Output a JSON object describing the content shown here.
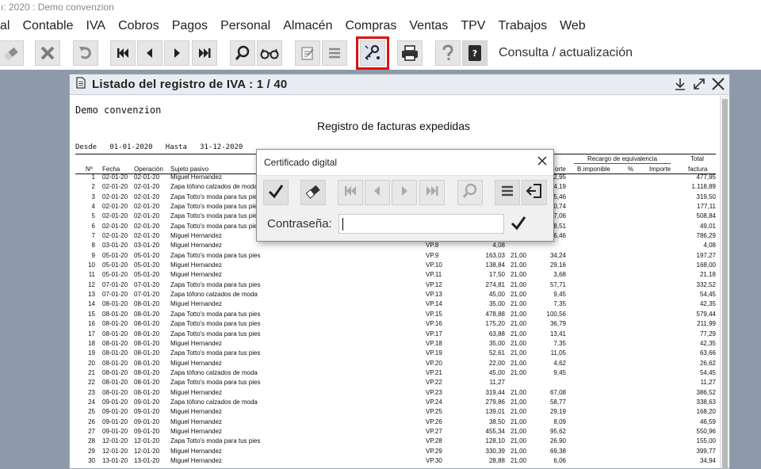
{
  "app": {
    "window_title": "ı: 2020 : Demo convenzion"
  },
  "menu": [
    "al",
    "Contable",
    "IVA",
    "Cobros",
    "Pagos",
    "Personal",
    "Almacén",
    "Compras",
    "Ventas",
    "TPV",
    "Trabajos",
    "Web"
  ],
  "toolbar": {
    "status_label": "Consulta / actualización",
    "buttons": [
      "eraser-icon",
      "close-icon",
      "undo-icon",
      "first-icon",
      "prev-icon",
      "next-icon",
      "last-icon",
      "search-icon",
      "glasses-icon",
      "edit-icon",
      "list-icon",
      "digital-certificate-icon",
      "printer-icon",
      "help-icon",
      "calculator-icon"
    ],
    "highlight_color": "#e01010"
  },
  "document": {
    "title": "Listado del registro de IVA  :  1  /  40",
    "company": "Demo convenzion",
    "report_title": "Registro de facturas expedidas",
    "range": "Desde   01-01-2020   Hasta   31-12-2020",
    "headers": {
      "num": "Nº",
      "fecha": "Fecha",
      "operacion": "Operación",
      "sujeto": "Sujeto pasivo",
      "cuota_importe": "orte",
      "recargo": "Recargo de equivalencia",
      "recargo_base": "B.imponible",
      "recargo_pct": "%",
      "recargo_importe": "Importe",
      "total": "Total",
      "total_sub": "factura"
    },
    "rows": [
      {
        "n": "1",
        "f": "02-01-20",
        "o": "02-01-20",
        "s": "Miguel Hernandez",
        "d": "",
        "b": "",
        "p": "",
        "i": "2,95",
        "t": "477,95"
      },
      {
        "n": "2",
        "f": "02-01-20",
        "o": "02-01-20",
        "s": "Zapa tófono calzados de moda",
        "d": "",
        "b": "",
        "p": "",
        "i": "4,19",
        "t": "1.118,89"
      },
      {
        "n": "3",
        "f": "02-01-20",
        "o": "02-01-20",
        "s": "Zapa Totto's moda para tus pies",
        "d": "",
        "b": "",
        "p": "",
        "i": "5,46",
        "t": "319,50"
      },
      {
        "n": "4",
        "f": "02-01-20",
        "o": "02-01-20",
        "s": "Zapa Totto's moda para tus pies",
        "d": "",
        "b": "",
        "p": "",
        "i": "0,74",
        "t": "177,11"
      },
      {
        "n": "5",
        "f": "02-01-20",
        "o": "02-01-20",
        "s": "Zapa Totto's moda para tus pies",
        "d": "",
        "b": "",
        "p": "",
        "i": "7,06",
        "t": "508,84"
      },
      {
        "n": "6",
        "f": "02-01-20",
        "o": "02-01-20",
        "s": "Zapa Totto's moda para tus pies",
        "d": "",
        "b": "",
        "p": "",
        "i": "8,51",
        "t": "49,01"
      },
      {
        "n": "7",
        "f": "02-01-20",
        "o": "02-01-20",
        "s": "Miguel Hernandez",
        "d": "",
        "b": "",
        "p": "",
        "i": "6,46",
        "t": "786,29"
      },
      {
        "n": "8",
        "f": "03-01-20",
        "o": "03-01-20",
        "s": "Miguel Hernandez",
        "d": "VP.8",
        "b": "4,08",
        "p": "",
        "i": "",
        "t": "4,08"
      },
      {
        "n": "9",
        "f": "05-01-20",
        "o": "05-01-20",
        "s": "Zapa Totto's moda para tus pies",
        "d": "VP.9",
        "b": "163,03",
        "p": "21,00",
        "i": "34,24",
        "t": "197,27"
      },
      {
        "n": "10",
        "f": "05-01-20",
        "o": "05-01-20",
        "s": "Miguel Hernandez",
        "d": "VP.10",
        "b": "138,84",
        "p": "21,00",
        "i": "29,16",
        "t": "168,00"
      },
      {
        "n": "11",
        "f": "05-01-20",
        "o": "05-01-20",
        "s": "Miguel Hernandez",
        "d": "VP.11",
        "b": "17,50",
        "p": "21,00",
        "i": "3,68",
        "t": "21,18"
      },
      {
        "n": "12",
        "f": "07-01-20",
        "o": "07-01-20",
        "s": "Zapa Totto's moda para tus pies",
        "d": "VP.12",
        "b": "274,81",
        "p": "21,00",
        "i": "57,71",
        "t": "332,52"
      },
      {
        "n": "13",
        "f": "07-01-20",
        "o": "07-01-20",
        "s": "Zapa tófono calzados de moda",
        "d": "VP.13",
        "b": "45,00",
        "p": "21,00",
        "i": "9,45",
        "t": "54,45"
      },
      {
        "n": "14",
        "f": "08-01-20",
        "o": "08-01-20",
        "s": "Miguel Hernandez",
        "d": "VP.14",
        "b": "35,00",
        "p": "21,00",
        "i": "7,35",
        "t": "42,35"
      },
      {
        "n": "15",
        "f": "08-01-20",
        "o": "08-01-20",
        "s": "Zapa Totto's moda para tus pies",
        "d": "VP.15",
        "b": "478,88",
        "p": "21,00",
        "i": "100,56",
        "t": "579,44"
      },
      {
        "n": "16",
        "f": "08-01-20",
        "o": "08-01-20",
        "s": "Zapa Totto's moda para tus pies",
        "d": "VP.16",
        "b": "175,20",
        "p": "21,00",
        "i": "36,79",
        "t": "211,99"
      },
      {
        "n": "17",
        "f": "08-01-20",
        "o": "08-01-20",
        "s": "Zapa Totto's moda para tus pies",
        "d": "VP.17",
        "b": "63,88",
        "p": "21,00",
        "i": "13,41",
        "t": "77,29"
      },
      {
        "n": "18",
        "f": "08-01-20",
        "o": "08-01-20",
        "s": "Miguel Hernandez",
        "d": "VP.18",
        "b": "35,00",
        "p": "21,00",
        "i": "7,35",
        "t": "42,35"
      },
      {
        "n": "19",
        "f": "08-01-20",
        "o": "08-01-20",
        "s": "Zapa Totto's moda para tus pies",
        "d": "VP.19",
        "b": "52,61",
        "p": "21,00",
        "i": "11,05",
        "t": "63,66"
      },
      {
        "n": "20",
        "f": "08-01-20",
        "o": "08-01-20",
        "s": "Miguel Hernandez",
        "d": "VP.20",
        "b": "22,00",
        "p": "21,00",
        "i": "4,62",
        "t": "26,62"
      },
      {
        "n": "21",
        "f": "08-01-20",
        "o": "08-01-20",
        "s": "Zapa tófono calzados de moda",
        "d": "VP.21",
        "b": "45,00",
        "p": "21,00",
        "i": "9,45",
        "t": "54,45"
      },
      {
        "n": "22",
        "f": "08-01-20",
        "o": "08-01-20",
        "s": "Zapa Totto's moda para tus pies",
        "d": "VP.22",
        "b": "11,27",
        "p": "",
        "i": "",
        "t": "11,27"
      },
      {
        "n": "23",
        "f": "08-01-20",
        "o": "08-01-20",
        "s": "Miguel Hernandez",
        "d": "VP.23",
        "b": "319,44",
        "p": "21,00",
        "i": "67,08",
        "t": "386,52"
      },
      {
        "n": "24",
        "f": "09-01-20",
        "o": "09-01-20",
        "s": "Zapa tófono calzados de moda",
        "d": "VP.24",
        "b": "279,86",
        "p": "21,00",
        "i": "58,77",
        "t": "338,63"
      },
      {
        "n": "25",
        "f": "09-01-20",
        "o": "09-01-20",
        "s": "Miguel Hernandez",
        "d": "VP.25",
        "b": "139,01",
        "p": "21,00",
        "i": "29,19",
        "t": "168,20"
      },
      {
        "n": "26",
        "f": "09-01-20",
        "o": "09-01-20",
        "s": "Miguel Hernandez",
        "d": "VP.26",
        "b": "38,50",
        "p": "21,00",
        "i": "8,09",
        "t": "46,59"
      },
      {
        "n": "27",
        "f": "09-01-20",
        "o": "09-01-20",
        "s": "Miguel Hernandez",
        "d": "VP.27",
        "b": "455,34",
        "p": "21,00",
        "i": "95,62",
        "t": "550,96"
      },
      {
        "n": "28",
        "f": "12-01-20",
        "o": "12-01-20",
        "s": "Zapa Totto's moda para tus pies",
        "d": "VP.28",
        "b": "128,10",
        "p": "21,00",
        "i": "26,90",
        "t": "155,00"
      },
      {
        "n": "29",
        "f": "12-01-20",
        "o": "12-01-20",
        "s": "Miguel Hernandez",
        "d": "VP.29",
        "b": "330,39",
        "p": "21,00",
        "i": "69,38",
        "t": "399,77"
      },
      {
        "n": "30",
        "f": "13-01-20",
        "o": "13-01-20",
        "s": "Miguel Hernandez",
        "d": "VP.30",
        "b": "28,88",
        "p": "21,00",
        "i": "6,06",
        "t": "34,94"
      }
    ]
  },
  "dialog": {
    "title": "Certificado digital",
    "password_label": "Contraseña:",
    "password_value": "",
    "tools": [
      "check-icon",
      "eraser-icon",
      "first-icon",
      "prev-icon",
      "next-icon",
      "last-icon",
      "search-icon",
      "list-icon",
      "exit-icon"
    ]
  }
}
